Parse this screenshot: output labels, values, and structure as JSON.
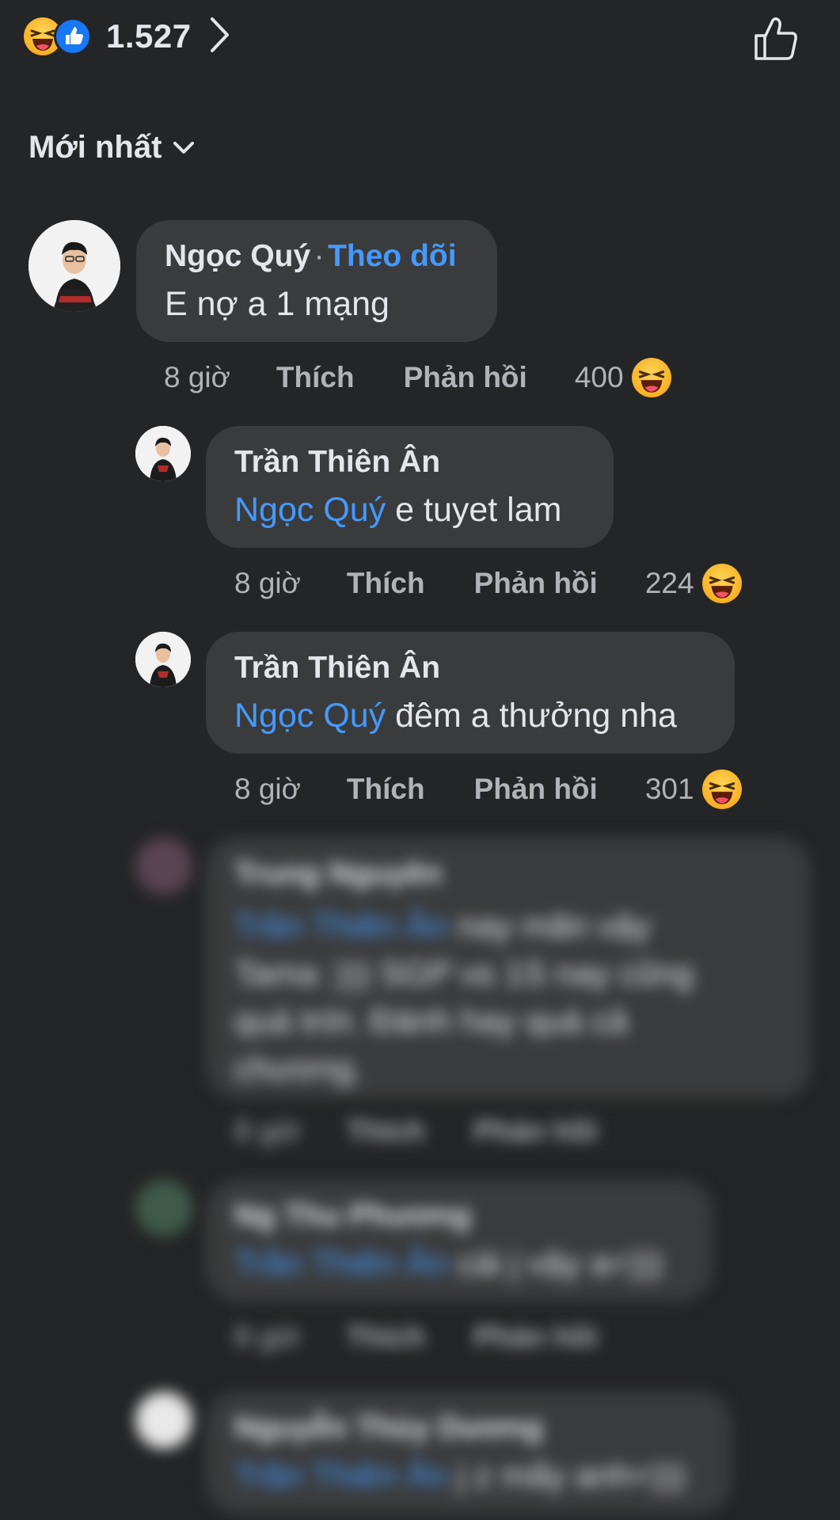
{
  "reactions": {
    "total": "1.527"
  },
  "sort": {
    "label": "Mới nhất"
  },
  "comments": [
    {
      "author": "Ngọc Quý",
      "follow": "Theo dõi",
      "separator": "·",
      "text": "E nợ a 1 mạng",
      "time": "8 giờ",
      "like": "Thích",
      "reply": "Phản hồi",
      "reaction_count": "400"
    }
  ],
  "replies": [
    {
      "author": "Trần Thiên Ân",
      "mention": "Ngọc Quý",
      "text": " e tuyet lam",
      "time": "8 giờ",
      "like": "Thích",
      "reply": "Phản hồi",
      "reaction_count": "224"
    },
    {
      "author": "Trần Thiên Ân",
      "mention": "Ngọc Quý",
      "text": " đêm a thưởng nha",
      "time": "8 giờ",
      "like": "Thích",
      "reply": "Phản hồi",
      "reaction_count": "301"
    },
    {
      "author": "Trung Nguyên",
      "mention": "Trần Thiên Ân",
      "text_lines": [
        " nay mãn vậy",
        "Tama :))) SGP vs 1S nay cũng",
        "quá trời. Đánh hay quá cả",
        "chương."
      ],
      "time": "8 giờ",
      "like": "Thích",
      "reply": "Phản hồi"
    },
    {
      "author": "Ng Thu Phương",
      "mention": "Trần Thiên Ân",
      "text": " cái j vậy a=)))",
      "time": "8 giờ",
      "like": "Thích",
      "reply": "Phản hồi"
    },
    {
      "author": "Nguyễn Thùy Dương",
      "mention": "Trần Thiên Ân",
      "text": " j z mấy anh=)))"
    }
  ],
  "colors": {
    "background": "#242526",
    "bubble": "#3a3b3c",
    "link": "#4599ff",
    "secondary": "#b0b3b8"
  }
}
